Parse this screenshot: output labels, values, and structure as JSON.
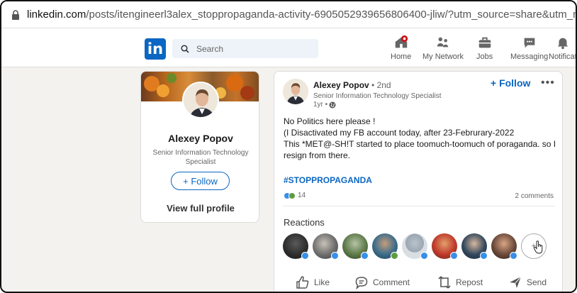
{
  "browser": {
    "url_host": "linkedin.com",
    "url_path": "/posts/itengineerl3alex_stoppropaganda-activity-6905052939656806400-jliw/?utm_source=share&utm_medium=membe"
  },
  "nav": {
    "logo": "in",
    "search_placeholder": "Search",
    "items": [
      {
        "label": "Home",
        "icon": "home-icon"
      },
      {
        "label": "My Network",
        "icon": "people-icon"
      },
      {
        "label": "Jobs",
        "icon": "briefcase-icon"
      },
      {
        "label": "Messaging",
        "icon": "chat-icon"
      },
      {
        "label": "Notificat",
        "icon": "bell-icon"
      }
    ]
  },
  "profile_card": {
    "name": "Alexey Popov",
    "headline": "Senior Information Technology Specialist",
    "follow_label": "+ Follow",
    "view_profile_label": "View full profile"
  },
  "post": {
    "author_name": "Alexey Popov",
    "author_degree": " • 2nd",
    "author_headline": "Senior Information Technology Specialist",
    "time": "1yr •",
    "follow_label": "+ Follow",
    "more_label": "•••",
    "body_lines": [
      "No Politics here please !",
      "(I Disactivated my FB account today, after 23-Februrary-2022",
      "This *MET@-SH!T started to place toomuch-toomuch of poraganda. so I",
      "resign from there."
    ],
    "hashtag": "#STOPPROPAGANDA",
    "reaction_count": "14",
    "comments": "2 comments",
    "reactions_title": "Reactions",
    "reactors_more": "+",
    "actions": {
      "like": "Like",
      "comment": "Comment",
      "repost": "Repost",
      "send": "Send"
    }
  },
  "colors": {
    "brand": "#0a66c2",
    "notification_badge": "#cc1016",
    "like_blue": "#378fe9",
    "support_green": "#5f9b41"
  }
}
